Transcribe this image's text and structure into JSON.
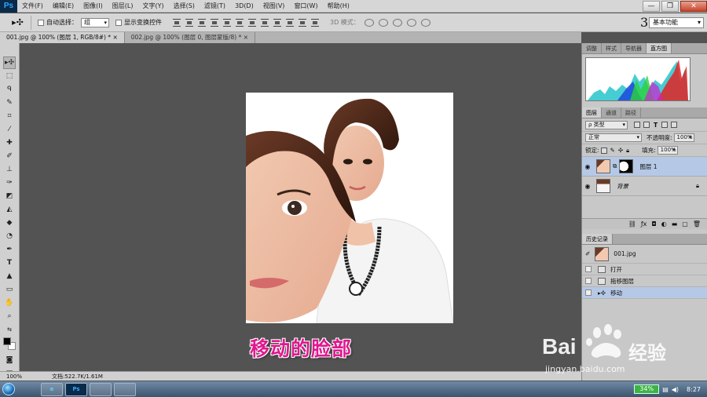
{
  "app": {
    "logo": "Ps"
  },
  "menu": [
    "文件(F)",
    "编辑(E)",
    "图像(I)",
    "图层(L)",
    "文字(Y)",
    "选择(S)",
    "滤镜(T)",
    "3D(D)",
    "视图(V)",
    "窗口(W)",
    "帮助(H)"
  ],
  "window_controls": {
    "minimize": "—",
    "restore": "❐",
    "close": "✕"
  },
  "options": {
    "auto_select_label": "自动选择：",
    "auto_select_value": "组",
    "show_transform_label": "显示变换控件",
    "mode_label": "3D 模式：",
    "workspace_number": "3",
    "workspace": "基本功能"
  },
  "tabs": [
    {
      "label": "001.jpg @ 100% (图层 1, RGB/8#) *",
      "close": "×"
    },
    {
      "label": "002.jpg @ 100% (图层 0, 图层蒙版/8) *",
      "close": "×"
    }
  ],
  "status": {
    "zoom": "100%",
    "doc_size": "文档:522.7K/1.61M"
  },
  "caption": "移动的脸部",
  "panels": {
    "top_tabs": [
      "调整",
      "样式",
      "导航器",
      "直方图"
    ],
    "layer_tabs": [
      "图层",
      "通道",
      "路径"
    ],
    "kind_label": "ρ 类型",
    "blend_mode": "正常",
    "opacity_label": "不透明度:",
    "opacity_value": "100%",
    "lock_label": "锁定:",
    "fill_label": "填充:",
    "fill_value": "100%",
    "layers": [
      {
        "name": "图层 1",
        "selected": true
      },
      {
        "name": "背景",
        "selected": false
      }
    ],
    "history_title": "历史记录",
    "history_snapshot": "001.jpg",
    "history": [
      {
        "name": "打开",
        "selected": false
      },
      {
        "name": "拖移图层",
        "selected": false
      },
      {
        "name": "移动",
        "selected": true
      }
    ]
  },
  "taskbar": {
    "apps": [
      "e",
      "Ps",
      "",
      ""
    ],
    "battery": "34%",
    "time": "8:27"
  },
  "watermark": {
    "brand_latin": "Bai",
    "brand_cn": "经验",
    "url": "jingyan.baidu.com"
  }
}
